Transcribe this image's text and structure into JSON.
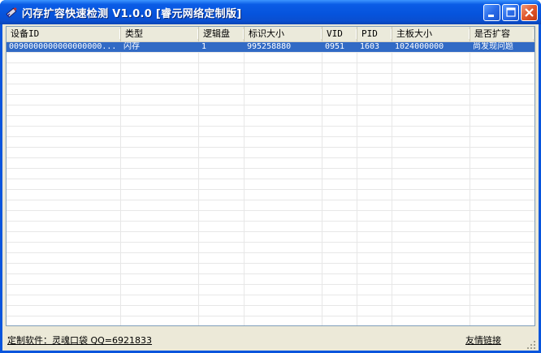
{
  "window": {
    "title": "闪存扩容快速检测 V1.0.0 [睿元网络定制版]",
    "icon": "usb-drive-icon",
    "accent_color": "#0855dd",
    "close_color": "#e0572c"
  },
  "list": {
    "columns": [
      "设备ID",
      "类型",
      "逻辑盘",
      "标识大小",
      "VID",
      "PID",
      "主板大小",
      "是否扩容"
    ],
    "rows": [
      [
        "0090000000000000000...",
        "闪存",
        "1",
        "995258880",
        "0951",
        "1603",
        "1024000000",
        "尚发现问题"
      ]
    ],
    "selected_row": 0,
    "selection_color": "#316ac5"
  },
  "status": {
    "left_text": "定制软件：灵魂口袋 QQ=6921833",
    "right_text": "友情链接"
  }
}
